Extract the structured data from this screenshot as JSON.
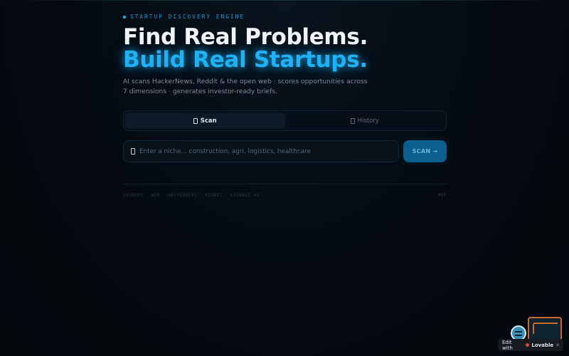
{
  "hero": {
    "eyebrow": "STARTUP DISCOVERY ENGINE",
    "headline_line1": "Find Real Problems.",
    "headline_line2": "Build Real Startups.",
    "subtitle": "AI scans HackerNews, Reddit & the open web · scores opportunities across 7 dimensions · generates investor-ready briefs."
  },
  "tabs": [
    {
      "label": "Scan",
      "icon": "scan-icon",
      "active": true
    },
    {
      "label": "History",
      "icon": "history-icon",
      "active": false
    }
  ],
  "search": {
    "placeholder": "Enter a niche... construction, agri, logistics, healthcare",
    "value": ""
  },
  "scan_button": {
    "label": "SCAN →"
  },
  "sources": {
    "items": [
      "SOURCES",
      "WEB",
      "HACKERNEWS",
      "REDDIT",
      "LOVABLE AI"
    ],
    "right": "MVP"
  },
  "badge": {
    "prefix": "Edit with",
    "brand": "Lovable",
    "close": "✕"
  },
  "colors": {
    "accent": "#1fb0f5",
    "background": "#040a10",
    "button": "#0a5f8e",
    "badge_orange": "#c9692f"
  }
}
